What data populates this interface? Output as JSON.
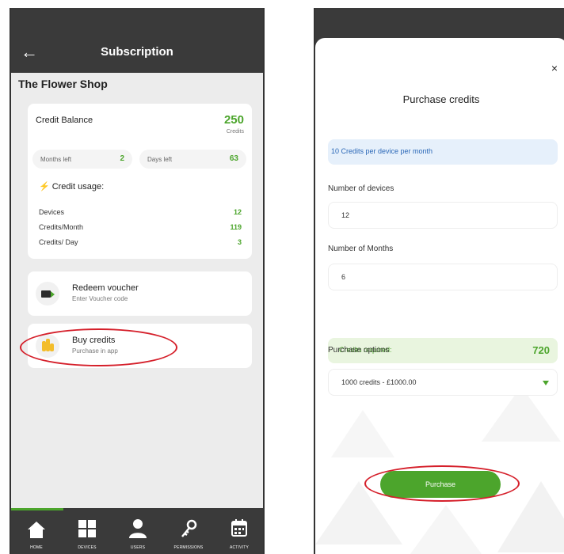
{
  "left": {
    "header": {
      "back_icon": "←",
      "title": "Subscription"
    },
    "shop_name": "The Flower Shop",
    "credit_balance": {
      "label": "Credit Balance",
      "value": "250",
      "unit": "Credits",
      "months_left_label": "Months left",
      "months_left_value": "2",
      "days_left_label": "Days left",
      "days_left_value": "63"
    },
    "usage": {
      "heading": "Credit usage:",
      "bolt_icon": "⚡",
      "rows": [
        {
          "label": "Devices",
          "value": "12"
        },
        {
          "label": "Credits/Month",
          "value": "119"
        },
        {
          "label": "Credits/ Day",
          "value": "3"
        }
      ]
    },
    "redeem": {
      "title": "Redeem voucher",
      "subtitle": "Enter Voucher code",
      "icon": "video-camera-icon"
    },
    "buy": {
      "title": "Buy credits",
      "subtitle": "Purchase in app",
      "icon": "coins-icon"
    },
    "bottom_nav": [
      {
        "label": "HOME",
        "icon": "home-icon"
      },
      {
        "label": "DEVICES",
        "icon": "grid-icon"
      },
      {
        "label": "USERS",
        "icon": "user-icon"
      },
      {
        "label": "PERMISSIONS",
        "icon": "key-icon"
      },
      {
        "label": "ACTIVITY",
        "icon": "calendar-icon"
      }
    ],
    "active_nav": "HOME"
  },
  "right": {
    "close_icon": "×",
    "title": "Purchase credits",
    "info": "10 Credits per device per month",
    "devices_label": "Number of devices",
    "devices_value": "12",
    "months_label": "Number of Months",
    "months_value": "6",
    "credits_required_label": "Credits required:",
    "credits_required_value": "720",
    "purchase_options_label": "Purchase options",
    "purchase_option_selected": "1000 credits - £1000.00",
    "purchase_button": "Purchase"
  },
  "colors": {
    "accent_green": "#4ca52c",
    "dark_bar": "#3a3a3a",
    "highlight_red": "#d51f2a",
    "info_blue": "#2a67b7"
  }
}
